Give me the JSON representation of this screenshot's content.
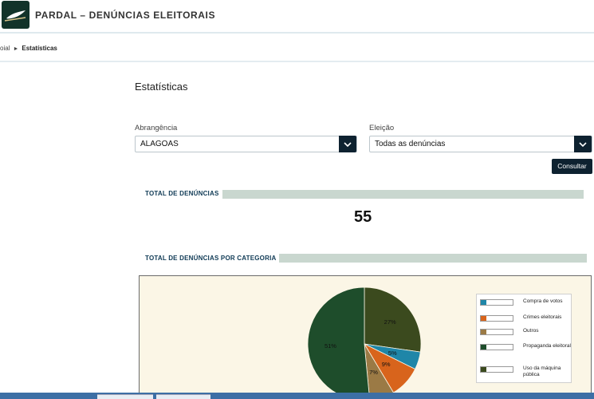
{
  "header": {
    "title": "PARDAL – DENÚNCIAS ELEITORAIS"
  },
  "breadcrumb": {
    "prev": "oial",
    "separator": "►",
    "current": "Estatísticas"
  },
  "page": {
    "title": "Estatísticas"
  },
  "filters": {
    "abrangencia": {
      "label": "Abrangência",
      "value": "ALAGOAS"
    },
    "eleicao": {
      "label": "Eleição",
      "value": "Todas as denúncias"
    },
    "submit_label": "Consultar"
  },
  "total": {
    "title": "TOTAL DE DENÚNCIAS",
    "value": "55"
  },
  "category": {
    "title": "TOTAL DE DENÚNCIAS POR CATEGORIA"
  },
  "chart_data": {
    "type": "pie",
    "categories": [
      "Compra de votos",
      "Crimes eleitorais",
      "Outros",
      "Propaganda eleitoral",
      "Uso da máquina pública"
    ],
    "values": [
      5,
      9,
      7,
      51,
      27
    ],
    "labels": [
      "5%",
      "9%",
      "7%",
      "51%",
      "27%"
    ],
    "colors": [
      "#1f86a8",
      "#d8641c",
      "#9b7a45",
      "#1e4d2b",
      "#3b4a1e"
    ]
  }
}
